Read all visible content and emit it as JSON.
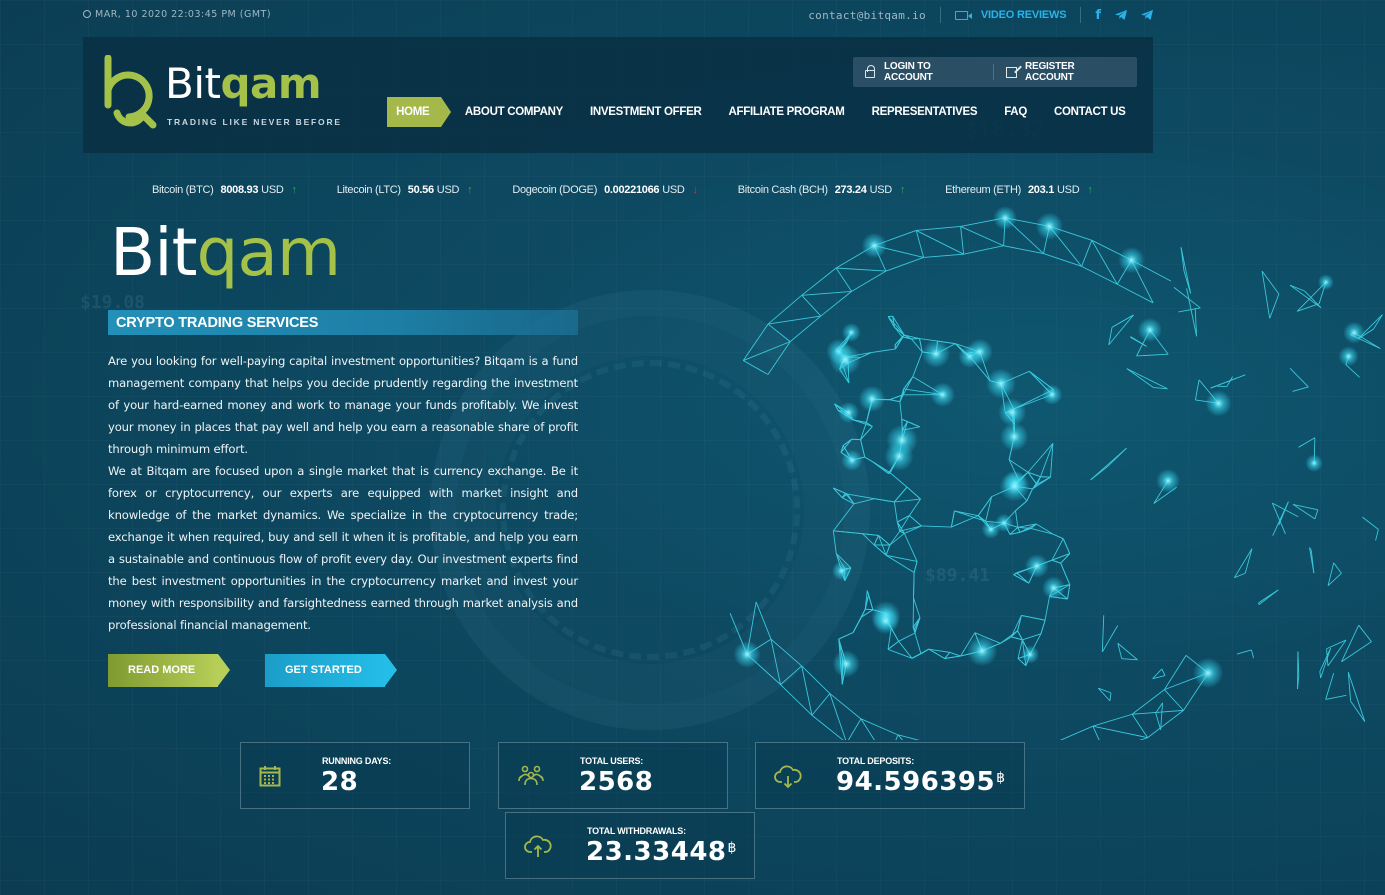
{
  "topbar": {
    "datetime": "MAR, 10 2020 22:03:45 PM (GMT)",
    "email": "contact@bitqam.io",
    "video_reviews": "VIDEO REVIEWS",
    "social": [
      {
        "name": "facebook",
        "glyph": "f"
      },
      {
        "name": "telegram",
        "glyph": "telegram"
      },
      {
        "name": "telegram",
        "glyph": "telegram"
      }
    ]
  },
  "header": {
    "logo": {
      "word_white": "Bit",
      "word_green": "qam",
      "tagline": "TRADING LIKE NEVER BEFORE"
    },
    "account": {
      "login": "LOGIN TO ACCOUNT",
      "register": "REGISTER ACCOUNT"
    },
    "nav": [
      {
        "label": "HOME",
        "active": true
      },
      {
        "label": "ABOUT COMPANY"
      },
      {
        "label": "INVESTMENT OFFER"
      },
      {
        "label": "AFFILIATE PROGRAM"
      },
      {
        "label": "REPRESENTATIVES"
      },
      {
        "label": "FAQ"
      },
      {
        "label": "CONTACT US"
      }
    ]
  },
  "ticker": [
    {
      "name": "Bitcoin (BTC)",
      "value": "8008.93",
      "currency": "USD",
      "trend": "up",
      "arrow": "↑"
    },
    {
      "name": "Litecoin (LTC)",
      "value": "50.56",
      "currency": "USD",
      "trend": "up",
      "arrow": "↑"
    },
    {
      "name": "Dogecoin (DOGE)",
      "value": "0.00221066",
      "currency": "USD",
      "trend": "down",
      "arrow": "↓"
    },
    {
      "name": "Bitcoin Cash (BCH)",
      "value": "273.24",
      "currency": "USD",
      "trend": "up",
      "arrow": "↑"
    },
    {
      "name": "Ethereum (ETH)",
      "value": "203.1",
      "currency": "USD",
      "trend": "up",
      "arrow": "↑"
    }
  ],
  "hero": {
    "title_white": "Bit",
    "title_green": "qam",
    "section_title": "CRYPTO TRADING SERVICES",
    "paragraphs": [
      "Are you looking for well-paying capital investment opportunities? Bitqam is a fund management company that helps you decide prudently regarding the investment of your hard-earned money and work to manage your funds profitably. We invest your money in places that pay well and help you earn a reasonable share of profit through minimum effort.",
      "We at Bitqam are focused upon a single market that is currency exchange. Be it forex or cryptocurrency, our experts are equipped with market insight and knowledge of the market dynamics. We specialize in the cryptocurrency trade; exchange it when required, buy and sell it when it is profitable, and help you earn a sustainable and continuous flow of profit every day. Our investment experts find the best investment opportunities in the cryptocurrency market and invest your money with responsibility and farsightedness earned through market analysis and professional financial management."
    ],
    "read_more": "READ MORE",
    "get_started": "GET STARTED"
  },
  "stats": {
    "running_days": {
      "label": "RUNNING DAYS:",
      "value": "28"
    },
    "total_users": {
      "label": "TOTAL USERS:",
      "value": "2568"
    },
    "total_deposits": {
      "label": "TOTAL DEPOSITS:",
      "value": "94.596395",
      "unit": "฿"
    },
    "total_withdrawals": {
      "label": "TOTAL WITHDRAWALS:",
      "value": "23.33448",
      "unit": "฿"
    }
  },
  "background": {
    "ghost_numbers": [
      "$19.08",
      "$18.32",
      "$89.41"
    ]
  },
  "colors": {
    "brand_green": "#a4c14a",
    "accent_blue": "#29b3e8",
    "up": "#2fa84f",
    "down": "#d43040"
  }
}
